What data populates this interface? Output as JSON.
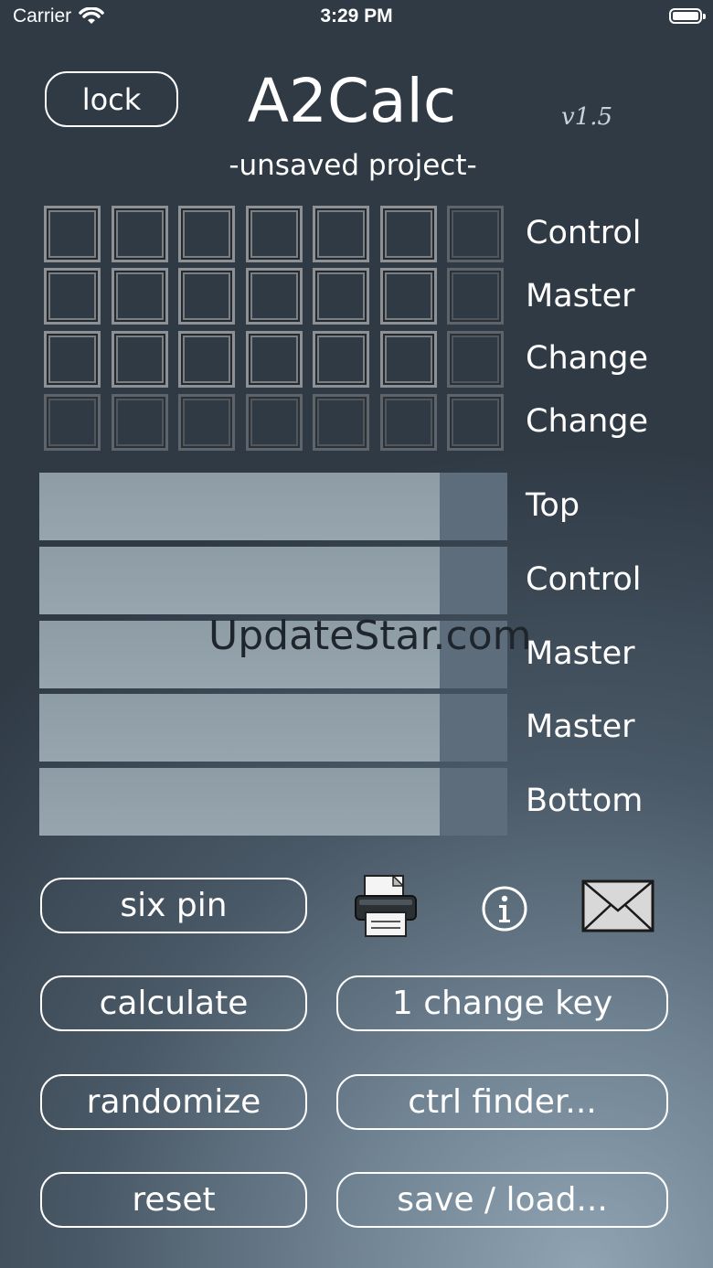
{
  "status_bar": {
    "carrier": "Carrier",
    "time": "3:29 PM",
    "battery_level": 1.0
  },
  "header": {
    "lock_label": "lock",
    "title": "A2Calc",
    "version": "v1.5",
    "project": "-unsaved project-"
  },
  "grid_rows": [
    "Control",
    "Master",
    "Change",
    "Change"
  ],
  "bars": [
    {
      "label": "Top",
      "fill": 0.855
    },
    {
      "label": "Control",
      "fill": 0.855
    },
    {
      "label": "Master",
      "fill": 0.855
    },
    {
      "label": "Master",
      "fill": 0.855
    },
    {
      "label": "Bottom",
      "fill": 0.855
    }
  ],
  "watermark": "UpdateStar.com",
  "buttons": {
    "six_pin": "six pin",
    "calculate": "calculate",
    "change_key": "1 change key",
    "randomize": "randomize",
    "ctrl_finder": "ctrl finder...",
    "reset": "reset",
    "save_load": "save / load..."
  },
  "icons": {
    "print": "printer-icon",
    "info": "info-icon",
    "mail": "envelope-icon"
  }
}
